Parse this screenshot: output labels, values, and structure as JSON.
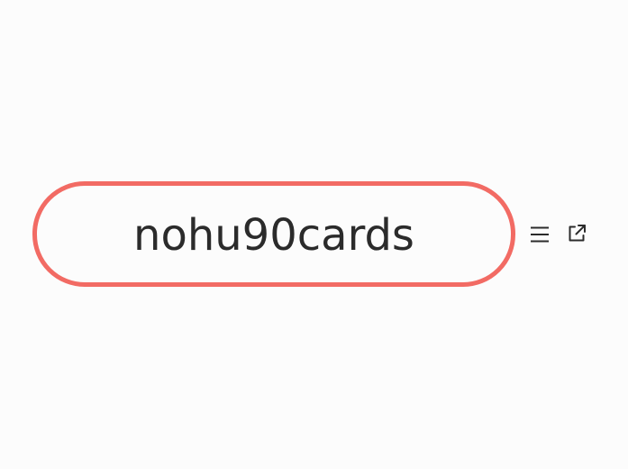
{
  "node": {
    "label": "nohu90cards",
    "border_color": "#f26b64",
    "text_color": "#2b2b2b"
  },
  "actions": {
    "menu_icon": "hamburger-menu-icon",
    "open_icon": "external-link-icon"
  },
  "colors": {
    "background": "#fcfcfc",
    "icon": "#2b2b2b"
  }
}
